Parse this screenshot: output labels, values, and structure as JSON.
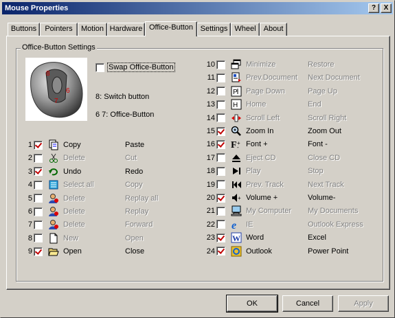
{
  "window": {
    "title": "Mouse Properties",
    "help_glyph": "?",
    "close_glyph": "X"
  },
  "tabs": [
    {
      "label": "Buttons"
    },
    {
      "label": "Pointers"
    },
    {
      "label": "Motion"
    },
    {
      "label": "Hardware"
    },
    {
      "label": "Office-Button"
    },
    {
      "label": "Settings"
    },
    {
      "label": "Wheel"
    },
    {
      "label": "About"
    }
  ],
  "group": {
    "title": "Office-Button Settings",
    "swap_label": "Swap Office-Button",
    "swap_checked": false,
    "info_line1": "8: Switch button",
    "info_line2": "6 7: Office-Button",
    "mouse_marks": [
      "8",
      "6",
      "7"
    ]
  },
  "left_rows": [
    {
      "num": "1",
      "checked": true,
      "enabled": true,
      "icon": "copy-icon",
      "action": "Copy",
      "alt": "Paste"
    },
    {
      "num": "2",
      "checked": false,
      "enabled": false,
      "icon": "scissors-icon",
      "action": "Delete",
      "alt": "Cut"
    },
    {
      "num": "3",
      "checked": true,
      "enabled": true,
      "icon": "undo-icon",
      "action": "Undo",
      "alt": "Redo"
    },
    {
      "num": "4",
      "checked": false,
      "enabled": false,
      "icon": "select-all-icon",
      "action": "Select all",
      "alt": "Copy"
    },
    {
      "num": "5",
      "checked": false,
      "enabled": false,
      "icon": "user-icon",
      "action": "Delete",
      "alt": "Replay all"
    },
    {
      "num": "6",
      "checked": false,
      "enabled": false,
      "icon": "user-icon",
      "action": "Delete",
      "alt": "Replay"
    },
    {
      "num": "7",
      "checked": false,
      "enabled": false,
      "icon": "user-icon",
      "action": "Delete",
      "alt": "Forward"
    },
    {
      "num": "8",
      "checked": false,
      "enabled": false,
      "icon": "new-file-icon",
      "action": "New",
      "alt": "Open"
    },
    {
      "num": "9",
      "checked": true,
      "enabled": true,
      "icon": "open-folder-icon",
      "action": "Open",
      "alt": "Close"
    }
  ],
  "right_rows": [
    {
      "num": "10",
      "checked": false,
      "enabled": false,
      "icon": "window-icon",
      "action": "Minimize",
      "alt": "Restore"
    },
    {
      "num": "11",
      "checked": false,
      "enabled": false,
      "icon": "document-icon",
      "action": "Prev.Document",
      "alt": "Next Document"
    },
    {
      "num": "12",
      "checked": false,
      "enabled": false,
      "icon": "page-icon",
      "action": "Page Down",
      "alt": "Page Up"
    },
    {
      "num": "13",
      "checked": false,
      "enabled": false,
      "icon": "home-end-icon",
      "action": "Home",
      "alt": "End"
    },
    {
      "num": "14",
      "checked": false,
      "enabled": false,
      "icon": "scroll-icon",
      "action": "Scroll Left",
      "alt": "Scroll Right"
    },
    {
      "num": "15",
      "checked": true,
      "enabled": true,
      "icon": "zoom-icon",
      "action": "Zoom In",
      "alt": "Zoom Out"
    },
    {
      "num": "16",
      "checked": true,
      "enabled": true,
      "icon": "font-icon",
      "action": "Font +",
      "alt": "Font -"
    },
    {
      "num": "17",
      "checked": false,
      "enabled": false,
      "icon": "eject-icon",
      "action": "Eject CD",
      "alt": "Close CD"
    },
    {
      "num": "18",
      "checked": false,
      "enabled": false,
      "icon": "play-icon",
      "action": "Play",
      "alt": "Stop"
    },
    {
      "num": "19",
      "checked": false,
      "enabled": false,
      "icon": "prev-track-icon",
      "action": "Prev. Track",
      "alt": "Next Track"
    },
    {
      "num": "20",
      "checked": true,
      "enabled": true,
      "icon": "volume-icon",
      "action": "Volume +",
      "alt": "Volume-"
    },
    {
      "num": "21",
      "checked": false,
      "enabled": false,
      "icon": "computer-icon",
      "action": "My Computer",
      "alt": "My Documents"
    },
    {
      "num": "22",
      "checked": false,
      "enabled": false,
      "icon": "ie-icon",
      "action": "IE",
      "alt": "Outlook Express"
    },
    {
      "num": "23",
      "checked": true,
      "enabled": true,
      "icon": "word-icon",
      "action": "Word",
      "alt": "Excel"
    },
    {
      "num": "24",
      "checked": true,
      "enabled": true,
      "icon": "outlook-icon",
      "action": "Outlook",
      "alt": "Power Point"
    }
  ],
  "buttons": {
    "ok": "OK",
    "cancel": "Cancel",
    "apply": "Apply"
  },
  "colors": {
    "title_start": "#0a246a",
    "title_end": "#a6caf0",
    "check": "#c00000",
    "face": "#d4d0c8"
  }
}
